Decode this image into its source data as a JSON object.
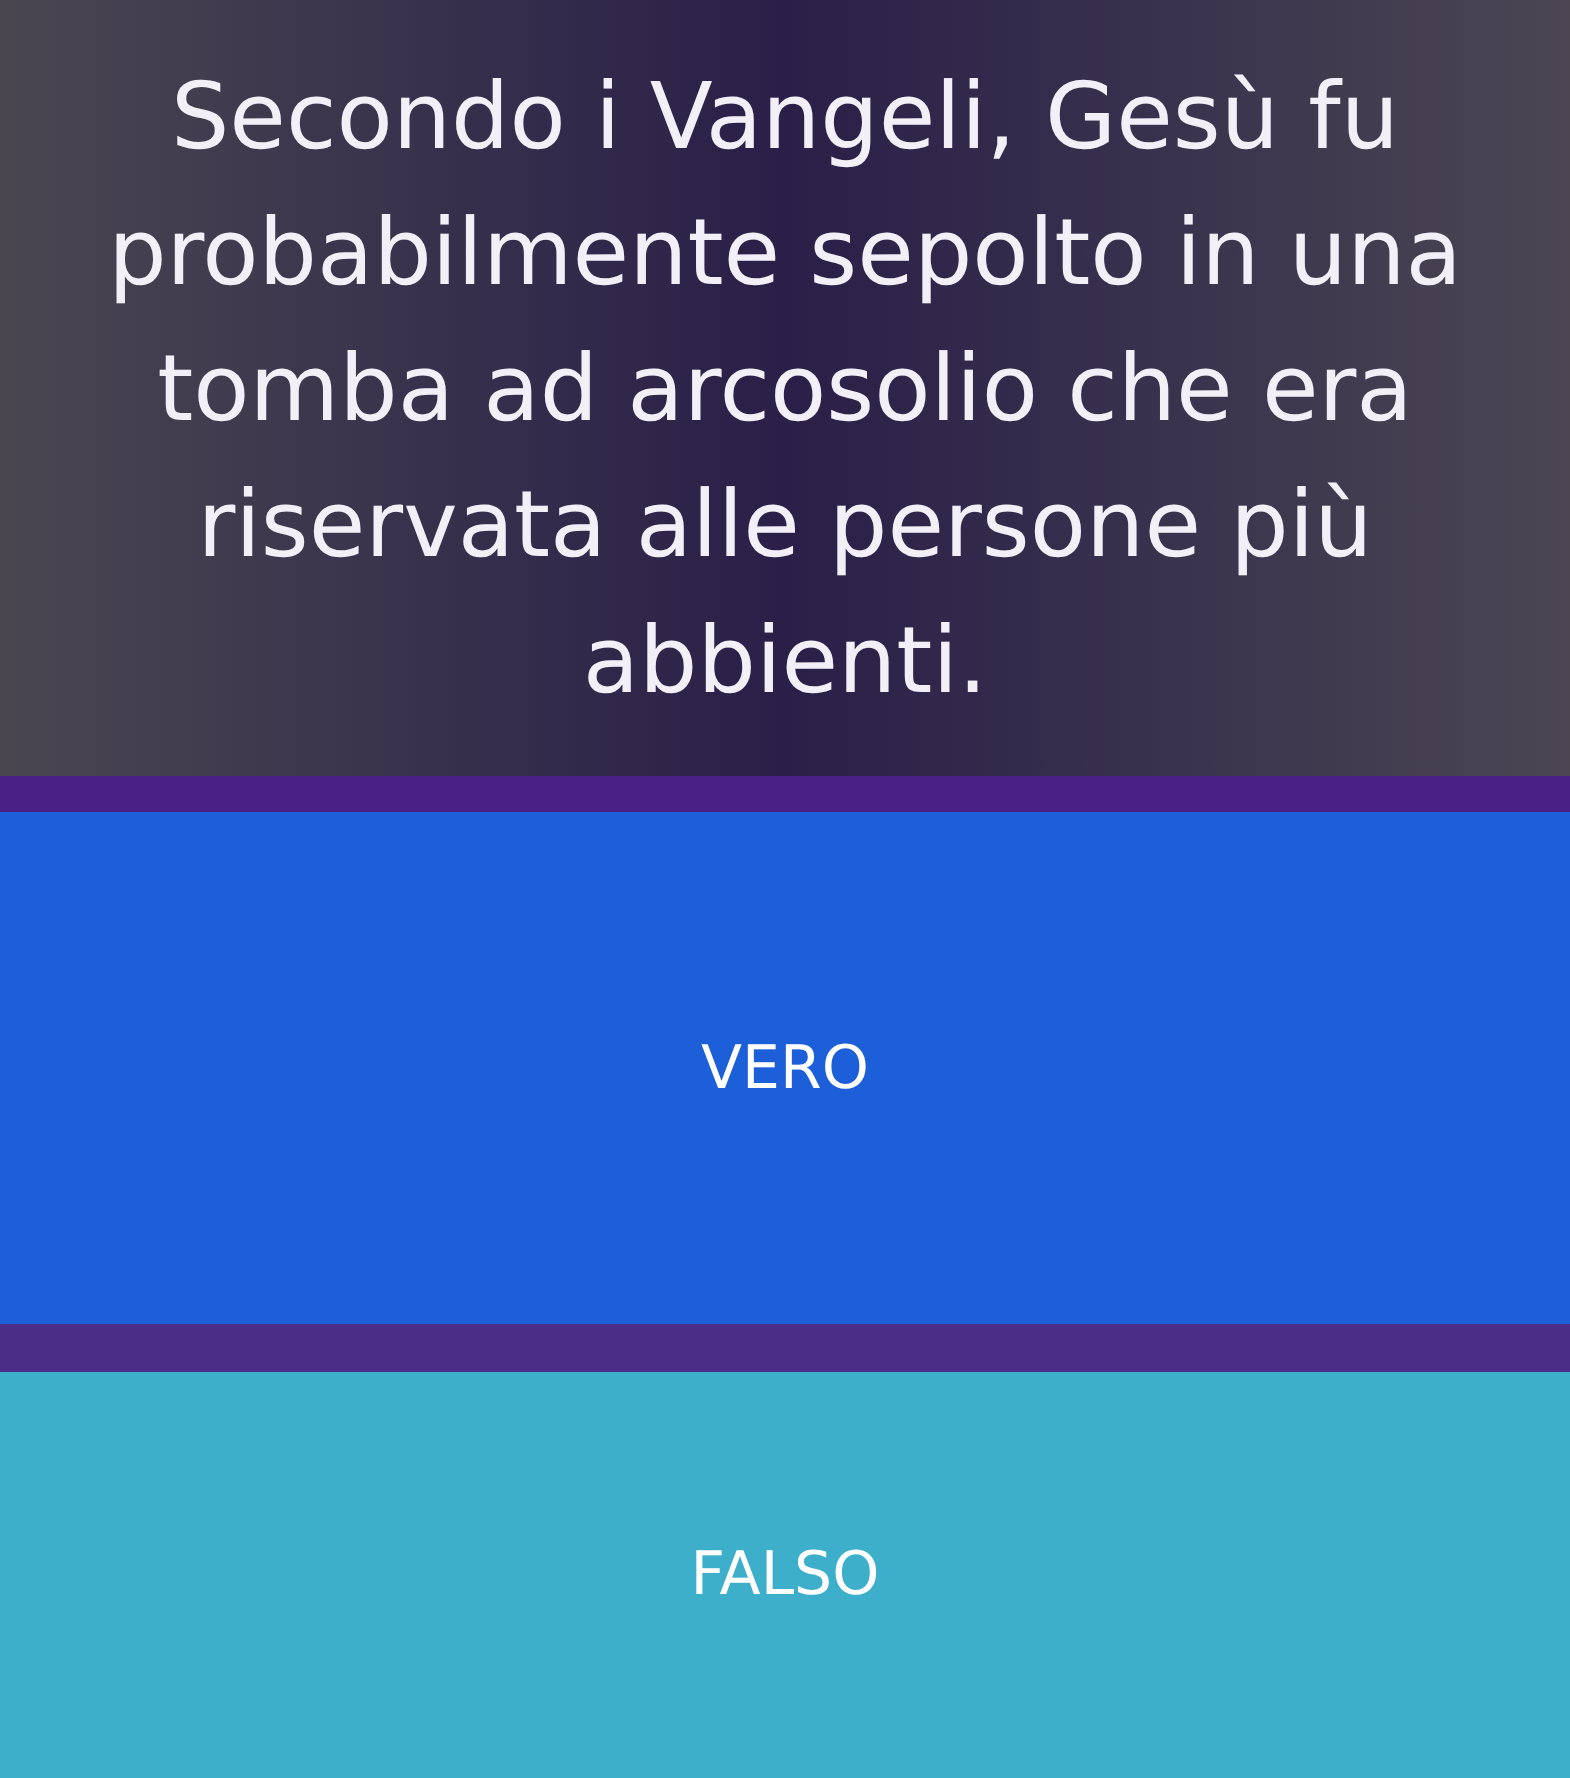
{
  "question": {
    "text": "Secondo i Vangeli, Gesù fu probabilmente sepolto in una tomba ad arcosolio che era riservata alle persone più abbienti."
  },
  "answers": [
    {
      "label": "VERO",
      "color": "#1c5fd8"
    },
    {
      "label": "FALSO",
      "color": "#3eafcb"
    }
  ]
}
